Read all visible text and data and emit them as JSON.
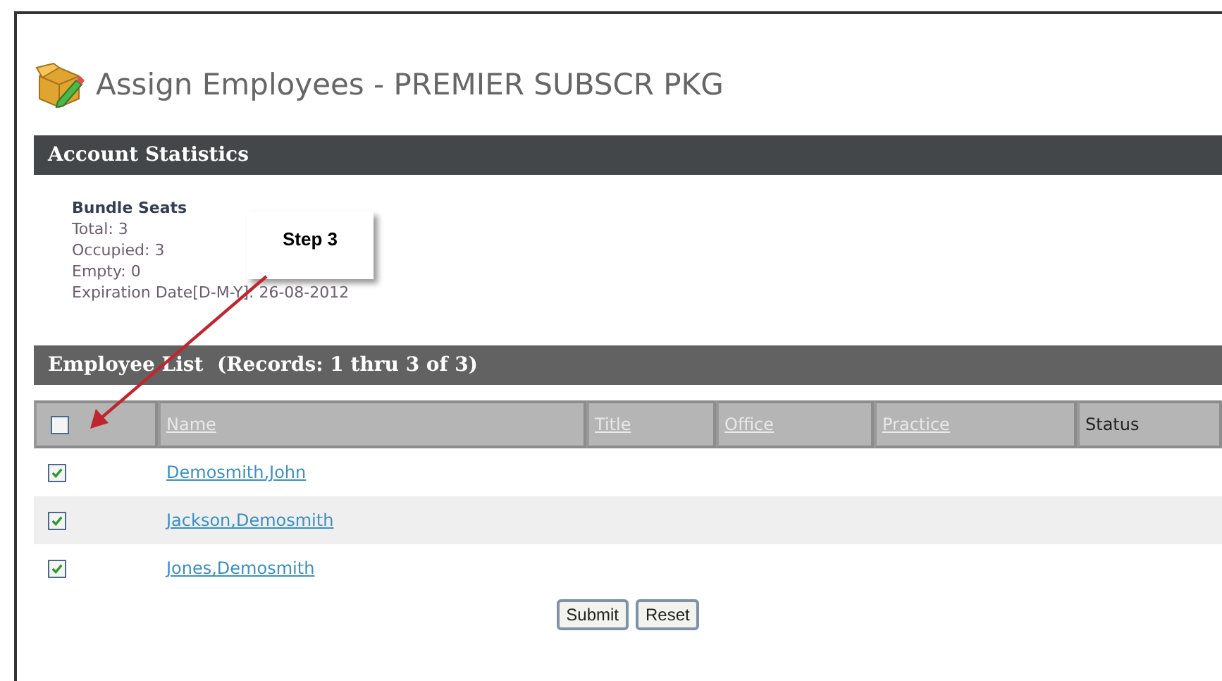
{
  "page": {
    "title": "Assign Employees - PREMIER SUBSCR PKG"
  },
  "account_statistics": {
    "heading": "Account Statistics",
    "group": "Bundle Seats",
    "lines": [
      "Total: 3",
      "Occupied: 3",
      "Empty: 0",
      "Expiration Date[D-M-Y]: 26-08-2012"
    ]
  },
  "callout": {
    "text": "Step 3"
  },
  "employee_list": {
    "heading": "Employee List  (Records: 1 thru 3 of 3)",
    "select_all": {
      "checked": false
    },
    "columns": [
      {
        "label": "Name",
        "sortable": true
      },
      {
        "label": "Title",
        "sortable": true
      },
      {
        "label": "Office",
        "sortable": true
      },
      {
        "label": "Practice",
        "sortable": true
      },
      {
        "label": "Status",
        "sortable": false
      }
    ],
    "rows": [
      {
        "name": "Demosmith,John",
        "checked": true
      },
      {
        "name": "Jackson,Demosmith",
        "checked": true
      },
      {
        "name": "Jones,Demosmith",
        "checked": true
      }
    ]
  },
  "buttons": [
    "Submit",
    "Reset"
  ]
}
